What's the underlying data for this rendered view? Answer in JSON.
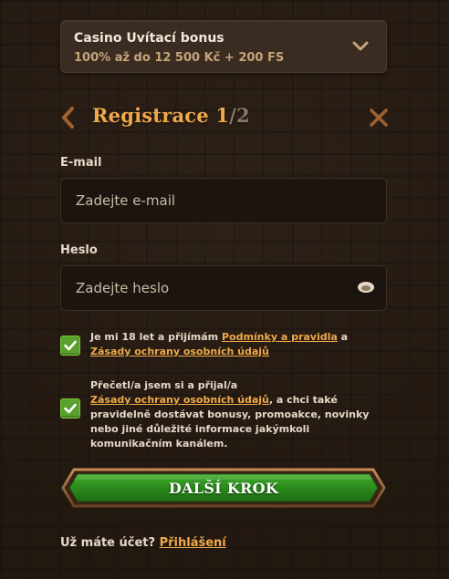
{
  "bonus": {
    "title": "Casino Uvítací bonus",
    "subtitle": "100% až do 12 500 Kč + 200 FS",
    "icon": "chevron-down-icon"
  },
  "header": {
    "title": "Registrace ",
    "step_current": "1",
    "step_separator": "/",
    "step_total": "2",
    "back_icon": "chevron-left-icon",
    "close_icon": "close-icon"
  },
  "form": {
    "email": {
      "label": "E-mail",
      "placeholder": "Zadejte e-mail",
      "value": ""
    },
    "password": {
      "label": "Heslo",
      "placeholder": "Zadejte heslo",
      "value": "",
      "icon": "eye-icon"
    }
  },
  "consents": [
    {
      "checked": true,
      "text_before": "Je mi 18 let a přijímám ",
      "link1": "Podmínky a pravidla",
      "text_middle": " a ",
      "link2": "Zásady ochrany osobních údajů",
      "text_after": ""
    },
    {
      "checked": true,
      "text_before": "Přečetl/a jsem si a přijal/a ",
      "link1": "Zásady ochrany osobních údajů",
      "text_after": ", a chci také pravidelně dostávat bonusy, promoakce, novinky nebo jiné důležité informace jakýmkoli komunikačním kanálem."
    }
  ],
  "next_button": {
    "label": "DALŠÍ KROK"
  },
  "login": {
    "prompt": "Už máte účet? ",
    "link": "Přihlášení"
  },
  "colors": {
    "accent": "#f0a94a",
    "checkbox": "#5aa02c",
    "button": "#2f8f1e",
    "background": "#2a1f16"
  }
}
